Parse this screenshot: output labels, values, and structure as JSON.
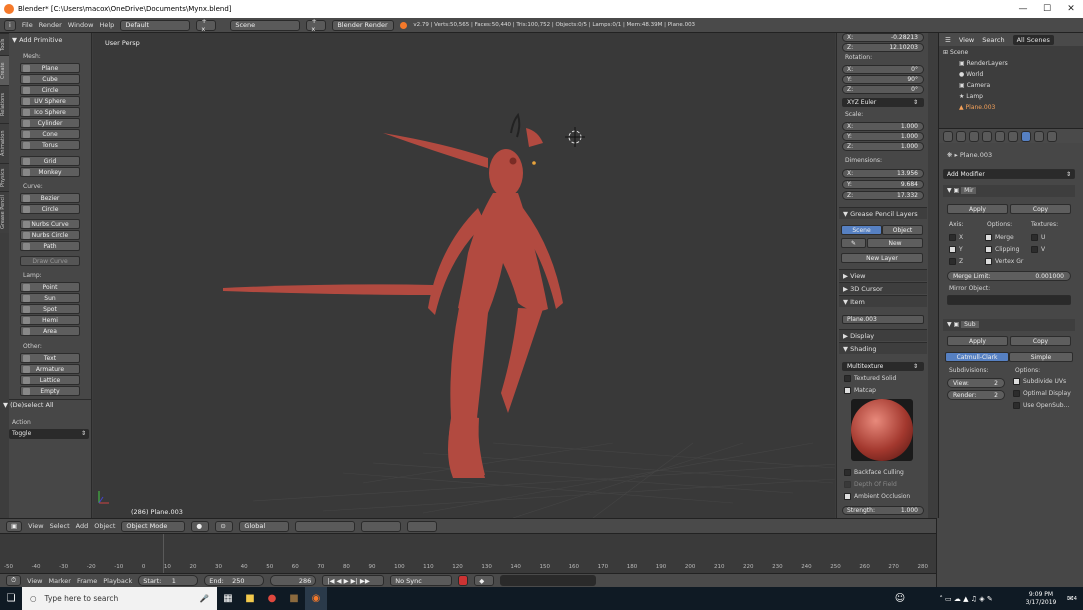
{
  "window": {
    "title": "Blender* [C:\\Users\\macox\\OneDrive\\Documents\\Mynx.blend]"
  },
  "infobar": {
    "menus": [
      "File",
      "Render",
      "Window",
      "Help"
    ],
    "layout": "Default",
    "scene": "Scene",
    "engine": "Blender Render",
    "stats": "v2.79 | Verts:50,565 | Faces:50,440 | Tris:100,752 | Objects:0/5 | Lamps:0/1 | Mem:48.39M | Plane.003"
  },
  "toolshelf": {
    "tabs": [
      "Tools",
      "Create",
      "Relations",
      "Animation",
      "Physics",
      "Grease Pencil"
    ],
    "panel_title": "Add Primitive",
    "mesh_label": "Mesh:",
    "mesh": [
      "Plane",
      "Cube",
      "Circle",
      "UV Sphere",
      "Ico Sphere",
      "Cylinder",
      "Cone",
      "Torus"
    ],
    "mesh2": [
      "Grid",
      "Monkey"
    ],
    "curve_label": "Curve:",
    "curve": [
      "Bezier",
      "Circle"
    ],
    "curve2": [
      "Nurbs Curve",
      "Nurbs Circle",
      "Path"
    ],
    "draw_curve": "Draw Curve",
    "lamp_label": "Lamp:",
    "lamp": [
      "Point",
      "Sun",
      "Spot",
      "Hemi",
      "Area"
    ],
    "other_label": "Other:",
    "other": [
      "Text",
      "Armature",
      "Lattice",
      "Empty"
    ],
    "op_title": "(De)select All",
    "action_label": "Action",
    "action_value": "Toggle"
  },
  "viewport": {
    "view_name": "User Persp",
    "object_label": "(286) Plane.003",
    "model_color": "#b24a40"
  },
  "npanel": {
    "loc_x": "-0.28213",
    "loc_z": "12.10203",
    "rotation_label": "Rotation:",
    "rot": [
      {
        "axis": "X:",
        "val": "0°"
      },
      {
        "axis": "Y:",
        "val": "90°"
      },
      {
        "axis": "Z:",
        "val": "0°"
      }
    ],
    "euler": "XYZ Euler",
    "scale_label": "Scale:",
    "scale": [
      {
        "axis": "X:",
        "val": "1.000"
      },
      {
        "axis": "Y:",
        "val": "1.000"
      },
      {
        "axis": "Z:",
        "val": "1.000"
      }
    ],
    "dims_label": "Dimensions:",
    "dims": [
      {
        "axis": "X:",
        "val": "13.956"
      },
      {
        "axis": "Y:",
        "val": "9.684"
      },
      {
        "axis": "Z:",
        "val": "17.332"
      }
    ],
    "gp_title": "Grease Pencil Layers",
    "gp_scene": "Scene",
    "gp_object": "Object",
    "gp_new": "New",
    "gp_new_layer": "New Layer",
    "view_head": "View",
    "cursor_head": "3D Cursor",
    "item_head": "Item",
    "item_name": "Plane.003",
    "display_head": "Display",
    "shading_head": "Shading",
    "shading_mode": "Multitexture",
    "textured_solid": "Textured Solid",
    "matcap": "Matcap",
    "backface": "Backface Culling",
    "dof": "Depth Of Field",
    "ao": "Ambient Occlusion",
    "strength_label": "Strength:",
    "strength_val": "1.000"
  },
  "outliner": {
    "tabs": [
      "View",
      "Search",
      "All Scenes"
    ],
    "rows": [
      "Scene",
      "RenderLayers",
      "World",
      "Camera",
      "Lamp",
      "Plane.003"
    ]
  },
  "properties": {
    "object": "Plane.003",
    "add_modifier": "Add Modifier",
    "mirror": {
      "name": "Mir",
      "apply": "Apply",
      "copy": "Copy",
      "axis_label": "Axis:",
      "options_label": "Options:",
      "textures_label": "Textures:",
      "axes": [
        "X",
        "Y",
        "Z"
      ],
      "options": [
        "Merge",
        "Clipping",
        "Vertex Gr"
      ],
      "textures": [
        "U",
        "V"
      ],
      "merge_limit_label": "Merge Limit:",
      "merge_limit": "0.001000",
      "mirror_object_label": "Mirror Object:"
    },
    "subsurf": {
      "name": "Sub",
      "apply": "Apply",
      "copy": "Copy",
      "catmull": "Catmull-Clark",
      "simple": "Simple",
      "subdiv_label": "Subdivisions:",
      "options_label": "Options:",
      "view_label": "View:",
      "view_val": "2",
      "render_label": "Render:",
      "render_val": "2",
      "opts": [
        "Subdivide UVs",
        "Optimal Display",
        "Use OpenSub..."
      ]
    }
  },
  "viewheader": {
    "menus": [
      "View",
      "Select",
      "Add",
      "Object"
    ],
    "mode": "Object Mode",
    "orientation": "Global"
  },
  "timeline": {
    "ticks": [
      "-50",
      "-40",
      "-30",
      "-20",
      "-10",
      "0",
      "10",
      "20",
      "30",
      "40",
      "50",
      "60",
      "70",
      "80",
      "90",
      "100",
      "110",
      "120",
      "130",
      "140",
      "150",
      "160",
      "170",
      "180",
      "190",
      "200",
      "210",
      "220",
      "230",
      "240",
      "250",
      "260",
      "270",
      "280"
    ],
    "menus": [
      "View",
      "Marker",
      "Frame",
      "Playback"
    ],
    "start_label": "Start:",
    "start": "1",
    "end_label": "End:",
    "end": "250",
    "current": "286",
    "sync": "No Sync"
  },
  "taskbar": {
    "search": "Type here to search",
    "time": "9:09 PM",
    "date": "3/17/2019",
    "notif": "4"
  }
}
